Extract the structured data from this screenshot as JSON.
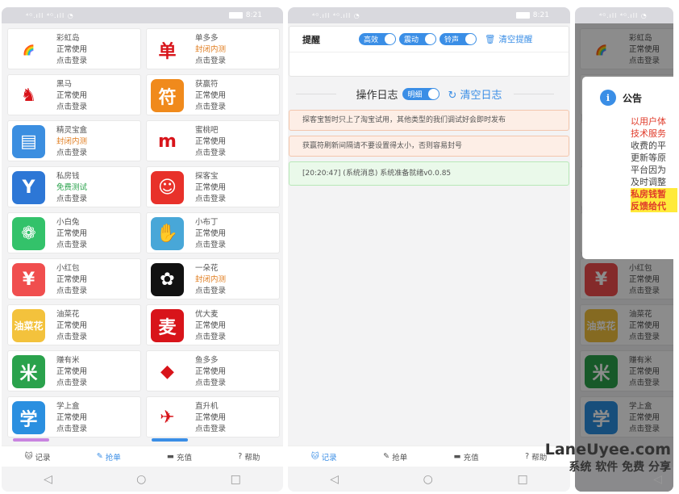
{
  "status": {
    "time": "8:21",
    "signal": "⁴ᴳ.ıll ⁴ᴳ.ıll ◔"
  },
  "apps": [
    {
      "name": "彩虹岛",
      "status": "正常使用",
      "action": "点击登录",
      "icon": "rainbow-icon",
      "bg": "#ffffff",
      "glyph": "🌈",
      "kind": "ok"
    },
    {
      "name": "单多多",
      "status": "封闭内测",
      "action": "点击登录",
      "icon": "dan-logo-icon",
      "bg": "#ffffff",
      "glyph": "单",
      "kind": "lock"
    },
    {
      "name": "黑马",
      "status": "正常使用",
      "action": "点击登录",
      "icon": "horse-icon",
      "bg": "#ffffff",
      "glyph": "♞",
      "kind": "ok"
    },
    {
      "name": "获赢符",
      "status": "正常使用",
      "action": "点击登录",
      "icon": "fu-charm-icon",
      "bg": "#f08a1c",
      "glyph": "符",
      "kind": "ok"
    },
    {
      "name": "精灵宝盒",
      "status": "封闭内测",
      "action": "点击登录",
      "icon": "treasure-box-icon",
      "bg": "#3b8ee0",
      "glyph": "▤",
      "kind": "lock"
    },
    {
      "name": "蜜桃吧",
      "status": "正常使用",
      "action": "点击登录",
      "icon": "peach-icon",
      "bg": "#ffffff",
      "glyph": "m",
      "kind": "ok"
    },
    {
      "name": "私房钱",
      "status": "免费测试",
      "action": "点击登录",
      "icon": "deer-icon",
      "bg": "#2d77d6",
      "glyph": "Y",
      "kind": "free"
    },
    {
      "name": "探客宝",
      "status": "正常使用",
      "action": "点击登录",
      "icon": "explorer-icon",
      "bg": "#e8312a",
      "glyph": "☺",
      "kind": "ok"
    },
    {
      "name": "小白兔",
      "status": "正常使用",
      "action": "点击登录",
      "icon": "rabbit-icon",
      "bg": "#33c26a",
      "glyph": "❁",
      "kind": "ok"
    },
    {
      "name": "小布丁",
      "status": "正常使用",
      "action": "点击登录",
      "icon": "pudding-icon",
      "bg": "#48a7d8",
      "glyph": "✋",
      "kind": "ok"
    },
    {
      "name": "小红包",
      "status": "正常使用",
      "action": "点击登录",
      "icon": "red-packet-icon",
      "bg": "#f04e4e",
      "glyph": "¥",
      "kind": "ok"
    },
    {
      "name": "一朵花",
      "status": "封闭内测",
      "action": "点击登录",
      "icon": "flower-icon",
      "bg": "#111111",
      "glyph": "✿",
      "kind": "lock"
    },
    {
      "name": "油菜花",
      "status": "正常使用",
      "action": "点击登录",
      "icon": "rapeseed-icon",
      "bg": "#f3c23c",
      "glyph": "油菜花",
      "kind": "ok"
    },
    {
      "name": "优大麦",
      "status": "正常使用",
      "action": "点击登录",
      "icon": "wheat-icon",
      "bg": "#d8141a",
      "glyph": "麦",
      "kind": "ok"
    },
    {
      "name": "赚有米",
      "status": "正常使用",
      "action": "点击登录",
      "icon": "rice-icon",
      "bg": "#2aa24c",
      "glyph": "米",
      "kind": "ok"
    },
    {
      "name": "鱼多多",
      "status": "正常使用",
      "action": "点击登录",
      "icon": "fish-icon",
      "bg": "#ffffff",
      "glyph": "◆",
      "kind": "ok"
    },
    {
      "name": "学上盒",
      "status": "正常使用",
      "action": "点击登录",
      "icon": "study-box-icon",
      "bg": "#2a8fe0",
      "glyph": "学",
      "kind": "ok"
    },
    {
      "name": "直升机",
      "status": "正常使用",
      "action": "点击登录",
      "icon": "helicopter-icon",
      "bg": "#ffffff",
      "glyph": "✈",
      "kind": "ok"
    }
  ],
  "tabs": [
    {
      "label": "记录",
      "icon": "record-icon",
      "glyph": "🐱"
    },
    {
      "label": "抢单",
      "icon": "grab-order-icon",
      "glyph": "✎"
    },
    {
      "label": "充值",
      "icon": "recharge-icon",
      "glyph": "▬"
    },
    {
      "label": "帮助",
      "icon": "help-icon",
      "glyph": "?"
    }
  ],
  "nav": {
    "back": "◁",
    "home": "○",
    "recent": "□"
  },
  "reminder": {
    "title": "提醒",
    "toggles": [
      "高效",
      "震动",
      "铃声"
    ],
    "clear": "清空提醒"
  },
  "log": {
    "title": "操作日志",
    "toggle": "明细",
    "clear": "清空日志"
  },
  "messages": [
    {
      "text": "探客宝暂时只上了淘宝试用，其他类型的我们调试好会即时发布",
      "type": "warn"
    },
    {
      "text": "获赢符刷新间隔请不要设置得太小，否则容易封号",
      "type": "warn"
    },
    {
      "text": "[20:20:47] (系统消息) 系统准备就绪v0.0.85",
      "type": "ok"
    }
  ],
  "notice": {
    "title": "公告",
    "lines": [
      {
        "text": "以用户体",
        "style": "r"
      },
      {
        "text": "技术服务",
        "style": "r"
      },
      {
        "text": "收费的平",
        "style": "n"
      },
      {
        "text": "更新等原",
        "style": "n"
      },
      {
        "text": "平台因为",
        "style": "n"
      },
      {
        "text": "及时调整",
        "style": "n"
      },
      {
        "text": "私房钱暂",
        "style": "y"
      },
      {
        "text": "反馈给代",
        "style": "y"
      }
    ]
  },
  "watermark": {
    "line1": "LaneUyee.com",
    "line2": "系统 软件 免费 分享"
  }
}
